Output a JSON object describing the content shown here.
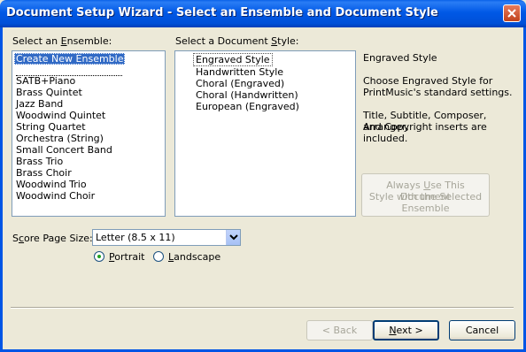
{
  "window": {
    "title": "Document Setup Wizard - Select an Ensemble and Document Style",
    "close_icon": "close-icon"
  },
  "ensemble": {
    "label_pre": "Select an ",
    "label_ul": "E",
    "label_post": "nsemble:",
    "items": [
      "Create New Ensemble",
      "SATB+Piano",
      "Brass Quintet",
      "Jazz Band",
      "Woodwind Quintet",
      "String Quartet",
      "Orchestra (String)",
      "Small Concert Band",
      "Brass Trio",
      "Brass Choir",
      "Woodwind Trio",
      "Woodwind Choir"
    ]
  },
  "style": {
    "label_pre": "Select a Document ",
    "label_ul": "S",
    "label_post": "tyle:",
    "items": [
      "Engraved Style",
      "Handwritten Style",
      "Choral (Engraved)",
      "Choral (Handwritten)",
      "European (Engraved)"
    ]
  },
  "description": {
    "title": "Engraved Style",
    "line1": "Choose Engraved Style for",
    "line2": "PrintMusic's standard settings.",
    "line3": "Title, Subtitle, Composer, Arranger,",
    "line4": "and Copyright inserts are included."
  },
  "always_button": {
    "pre": "Always ",
    "ul": "U",
    "post": "se This Document",
    "line2": "Style with the Selected",
    "line3": "Ensemble"
  },
  "page_size": {
    "label_pre": "S",
    "label_ul": "c",
    "label_post": "ore Page Size:",
    "value": "Letter (8.5 x 11)"
  },
  "orientation": {
    "portrait_ul": "P",
    "portrait_post": "ortrait",
    "landscape_ul": "L",
    "landscape_post": "andscape",
    "selected": "Portrait"
  },
  "buttons": {
    "back": "< Back",
    "back_ul": "B",
    "next_pre": "",
    "next_ul": "N",
    "next_post": "ext >",
    "cancel": "Cancel"
  }
}
